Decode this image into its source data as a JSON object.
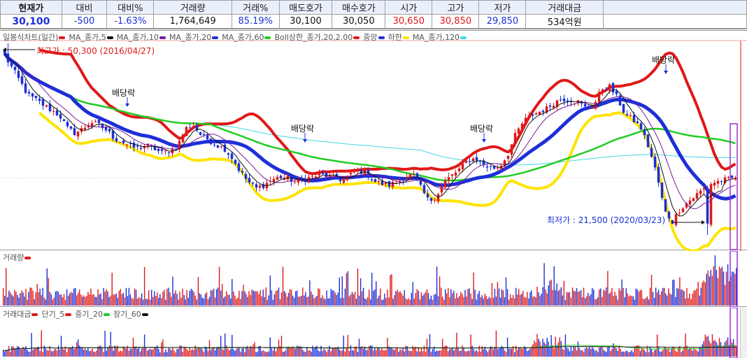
{
  "quote": {
    "headers": [
      "현재가",
      "대비",
      "대비%",
      "거래량",
      "거래%",
      "매도호가",
      "매수호가",
      "시가",
      "고가",
      "저가",
      "거래대금"
    ],
    "values": [
      "30,100",
      "-500",
      "-1.63%",
      "1,764,649",
      "85.19%",
      "30,100",
      "30,050",
      "30,650",
      "30,850",
      "29,850",
      "534억원"
    ],
    "value_colors": [
      "#1d2fd8",
      "#1d2fd8",
      "#1d2fd8",
      "#111111",
      "#1d2fd8",
      "#111111",
      "#111111",
      "#e01818",
      "#e01818",
      "#1d2fd8",
      "#111111"
    ]
  },
  "price_legend": [
    {
      "label": "일봉식차트(일간)",
      "color": "#e01818"
    },
    {
      "label": "MA_종가,5",
      "color": "#111111"
    },
    {
      "label": "MA_종가,10",
      "color": "#7a1a9a"
    },
    {
      "label": "MA_종가,20",
      "color": "#1d2fd8"
    },
    {
      "label": "MA_종가,60",
      "color": "#22cc22"
    },
    {
      "label": "Boll상한_종가,20,2.00",
      "color": "#e01818"
    },
    {
      "label": "중앙",
      "color": "#1d2fd8"
    },
    {
      "label": "하한",
      "color": "#ffe400"
    },
    {
      "label": "MA_종가,120",
      "color": "#40d8e8"
    }
  ],
  "annotations": {
    "high_label": "최고가 : 50,300 (2016/04/27)",
    "low_label": "최저가 : 21,500 (2020/03/23)",
    "dividend": [
      "배당락",
      "배당락",
      "배당락",
      "배당락"
    ]
  },
  "volume_legend": {
    "label": "거래량",
    "color": "#e01818"
  },
  "value_legend": [
    {
      "label": "거래대금",
      "color": "#e01818"
    },
    {
      "label": "단기_5",
      "color": "#e01818"
    },
    {
      "label": "중기_20",
      "color": "#22cc22"
    },
    {
      "label": "장기_60",
      "color": "#111111"
    }
  ],
  "colors": {
    "up": "#e01818",
    "down": "#1d2fd8",
    "bb_upper": "#e01818",
    "bb_middle": "#1d2fd8",
    "bb_lower": "#ffe400",
    "ma60": "#22cc22",
    "ma120": "#40d8e8",
    "highlight": "#9b30d9",
    "current_line": "#e01818"
  },
  "chart_data": {
    "type": "candlestick",
    "period": "daily",
    "price_range": [
      21500,
      50300
    ],
    "anchors": [
      {
        "date": "2016/04/27",
        "price": 50300
      },
      {
        "date": "2020/03/23",
        "price": 21500
      }
    ],
    "close_trend": [
      48500,
      46500,
      44500,
      42500,
      41800,
      41000,
      40200,
      39500,
      37500,
      36800,
      37500,
      38500,
      38000,
      37200,
      36000,
      35500,
      34800,
      34500,
      35000,
      34500,
      33800,
      34200,
      34800,
      37500,
      38000,
      36500,
      35800,
      35000,
      34500,
      33000,
      31000,
      29500,
      28500,
      29000,
      29800,
      30200,
      30000,
      29500,
      29800,
      30200,
      30500,
      30400,
      30000,
      29800,
      30500,
      31200,
      30800,
      29600,
      29200,
      29000,
      29500,
      30300,
      30500,
      28500,
      26500,
      27500,
      29500,
      30500,
      31500,
      32800,
      33000,
      32000,
      31500,
      31800,
      33500,
      36500,
      38500,
      39500,
      40000,
      40500,
      41500,
      42000,
      41800,
      41500,
      40500,
      41000,
      43500,
      43800,
      42000,
      39500,
      38800,
      37500,
      34500,
      30500,
      25000,
      23500,
      25500,
      26500,
      27500,
      28500,
      29300,
      29600,
      29800,
      30100
    ],
    "current": 30100
  }
}
